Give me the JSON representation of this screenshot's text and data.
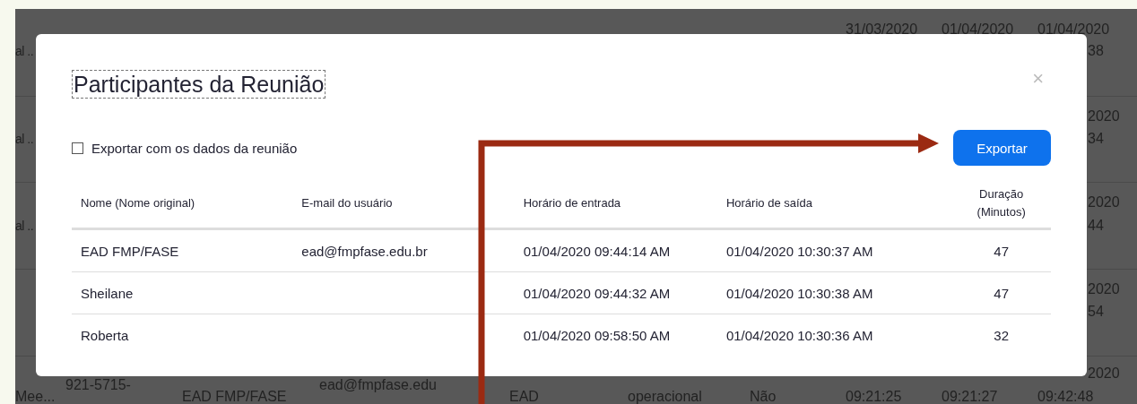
{
  "backdrop_texts": [
    "31/03/2020",
    "01/04/2020",
    "01/04/2020",
    "al ..",
    "38",
    "al ..",
    "2020",
    "34",
    "al ..",
    "2020",
    "44",
    "2020",
    "54",
    "Mee...",
    "921-5715-",
    "EAD FMP/FASE",
    "ead@fmpfase.edu",
    "EAD",
    "operacional",
    "Não",
    "09:21:25",
    "09:21:27",
    "2020",
    "09:42:48"
  ],
  "dialog": {
    "title": "Participantes da Reunião",
    "close": "×",
    "export_option": {
      "label": "Exportar com os dados da reunião",
      "checked": false
    },
    "export_button": "Exportar",
    "table": {
      "columns": [
        "Nome (Nome original)",
        "E-mail do usuário",
        "Horário de entrada",
        "Horário de saída",
        "Duração (Minutos)"
      ],
      "rows": [
        [
          "EAD FMP/FASE",
          "ead@fmpfase.edu.br",
          "01/04/2020 09:44:14 AM",
          "01/04/2020 10:30:37 AM",
          "47"
        ],
        [
          "Sheilane",
          "",
          "01/04/2020 09:44:32 AM",
          "01/04/2020 10:30:38 AM",
          "47"
        ],
        [
          "Roberta",
          "",
          "01/04/2020 09:58:50 AM",
          "01/04/2020 10:30:36 AM",
          "32"
        ]
      ]
    }
  }
}
